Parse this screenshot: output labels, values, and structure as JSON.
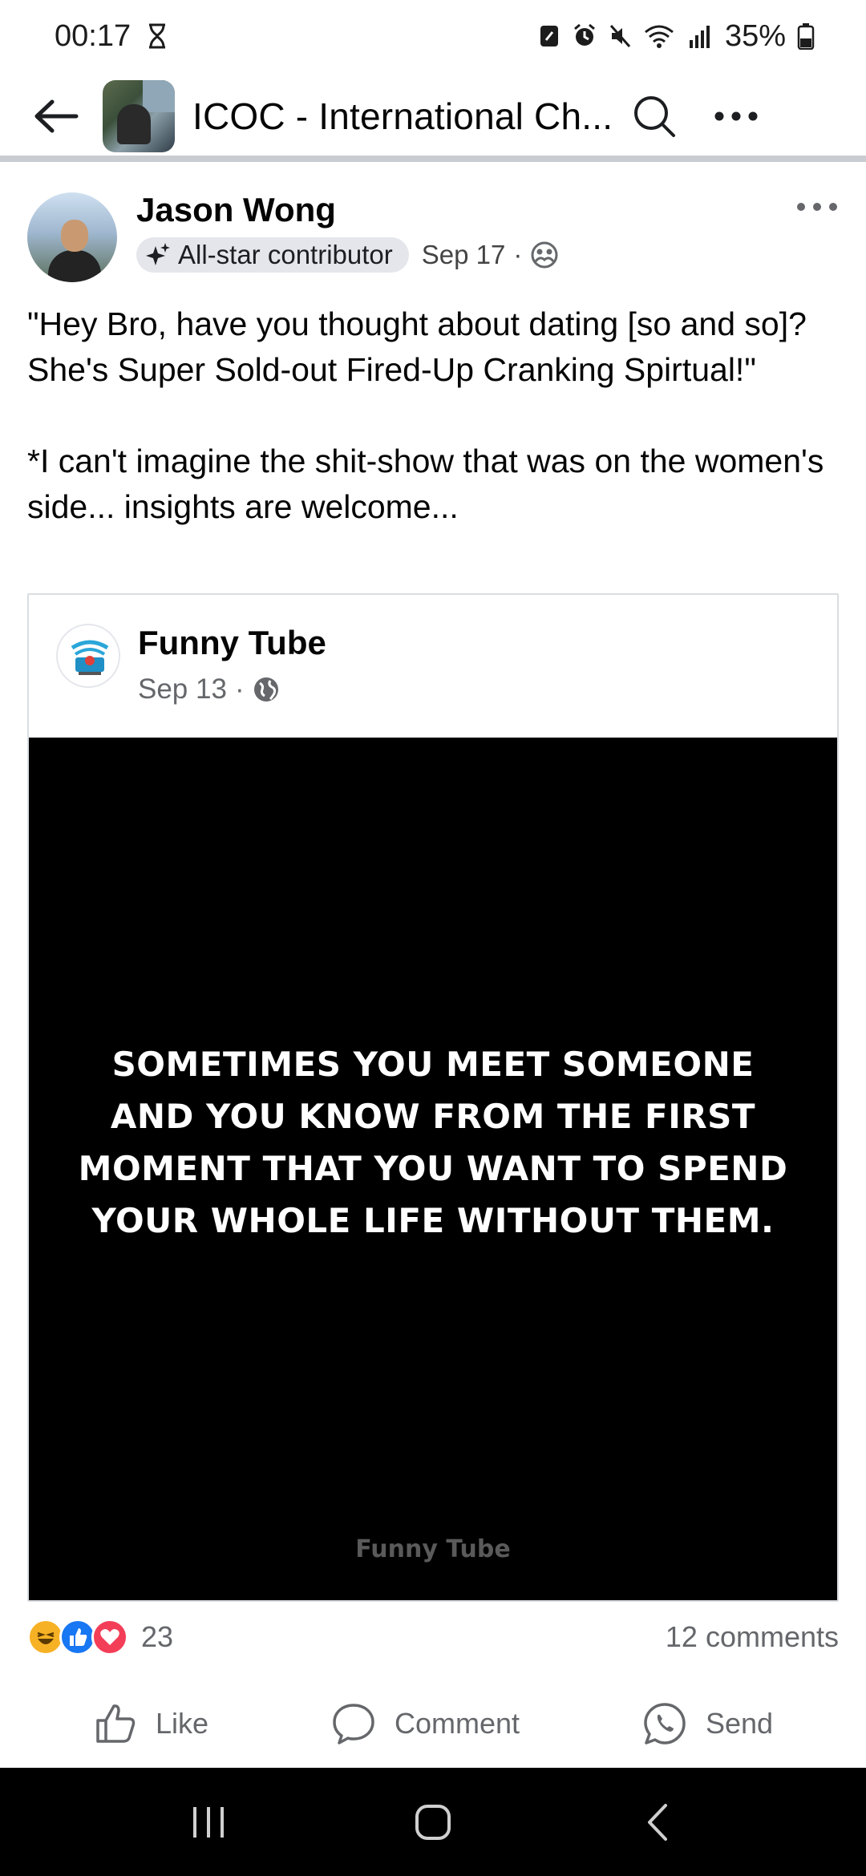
{
  "status_bar": {
    "time": "00:17",
    "battery": "35%"
  },
  "header": {
    "group_title": "ICOC - International Ch..."
  },
  "post": {
    "author": "Jason Wong",
    "badge": "All-star contributor",
    "date": "Sep 17",
    "separator": "·",
    "text_1": "\"Hey Bro, have you thought about dating [so and so]? She's Super Sold-out Fired-Up Cranking Spirtual!\"",
    "text_2": "*I can't imagine the shit-show that was on the women's side... insights are welcome..."
  },
  "shared": {
    "page_name": "Funny Tube",
    "date": "Sep 13",
    "separator": "·",
    "image_text": "SOMETIMES YOU MEET SOMEONE AND YOU KNOW FROM THE FIRST MOMENT THAT YOU WANT TO SPEND YOUR WHOLE LIFE WITHOUT THEM.",
    "watermark": "Funny Tube"
  },
  "engagement": {
    "reaction_count": "23",
    "comments": "12 comments"
  },
  "actions": {
    "like": "Like",
    "comment": "Comment",
    "send": "Send"
  },
  "icons": {
    "status": [
      "hourglass-icon",
      "nfc-icon",
      "alarm-icon",
      "mute-icon",
      "wifi-icon",
      "signal-icon",
      "battery-icon"
    ],
    "header": [
      "back-arrow-icon",
      "search-icon",
      "more-icon"
    ],
    "reactions": [
      "haha-reaction-icon",
      "like-reaction-icon",
      "love-reaction-icon"
    ],
    "nav": [
      "recents-icon",
      "home-icon",
      "back-icon"
    ]
  },
  "colors": {
    "like_blue": "#1877f2",
    "love_red": "#f33e58",
    "haha_yellow": "#f7b125",
    "secondary_text": "#65676b"
  }
}
